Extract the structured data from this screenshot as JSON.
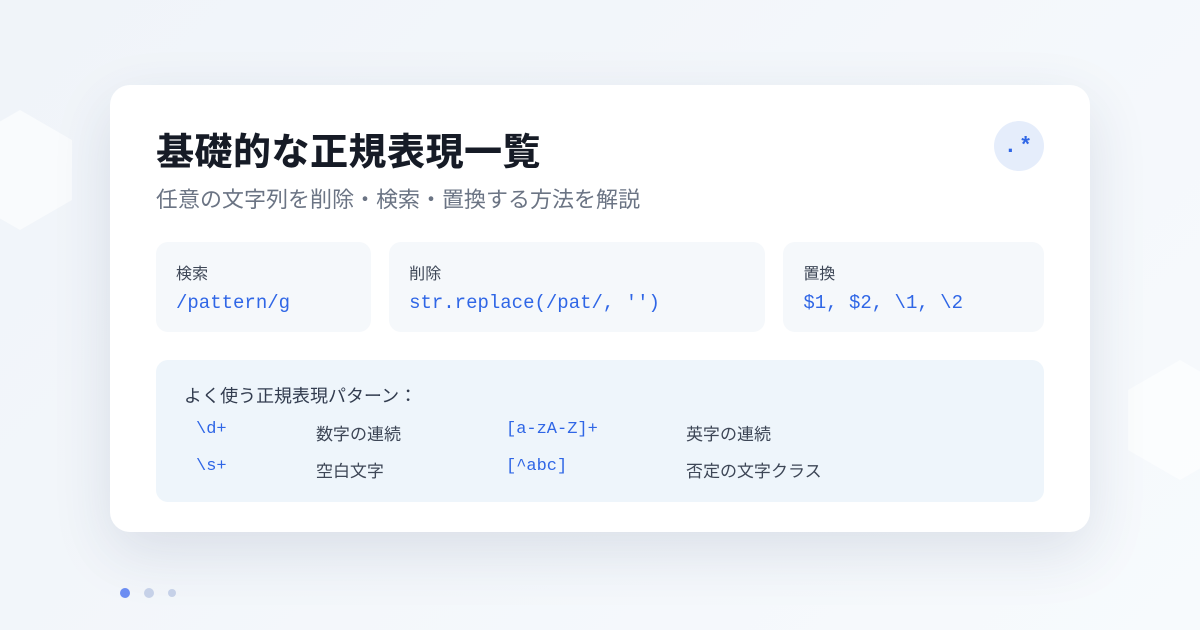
{
  "title": "基礎的な正規表現一覧",
  "subtitle": "任意の文字列を削除・検索・置換する方法を解説",
  "badge_symbol": ".*",
  "ops": {
    "search": {
      "label": "検索",
      "code": "/pattern/g"
    },
    "delete": {
      "label": "削除",
      "code": "str.replace(/pat/, '')"
    },
    "replace": {
      "label": "置換",
      "code": "$1, $2, \\1, \\2"
    }
  },
  "patterns_title": "よく使う正規表現パターン：",
  "patterns": [
    {
      "code": "\\d+",
      "desc": "数字の連続"
    },
    {
      "code": "[a-zA-Z]+",
      "desc": "英字の連続"
    },
    {
      "code": "\\s+",
      "desc": "空白文字"
    },
    {
      "code": "[^abc]",
      "desc": "否定の文字クラス"
    }
  ]
}
